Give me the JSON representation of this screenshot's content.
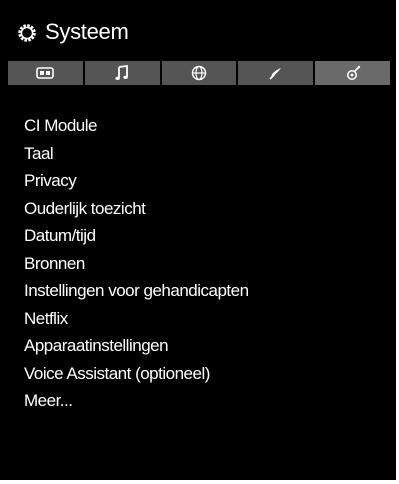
{
  "header": {
    "title": "Systeem",
    "icon": "settings-gear-icon"
  },
  "tabs": [
    {
      "icon": "picture-icon",
      "active": false
    },
    {
      "icon": "music-note-icon",
      "active": false
    },
    {
      "icon": "network-globe-icon",
      "active": false
    },
    {
      "icon": "installation-satellite-icon",
      "active": false
    },
    {
      "icon": "system-tools-icon",
      "active": true
    }
  ],
  "menu": {
    "items": [
      "CI Module",
      "Taal",
      "Privacy",
      "Ouderlijk toezicht",
      "Datum/tijd",
      "Bronnen",
      "Instellingen voor gehandicapten",
      "Netflix",
      "Apparaatinstellingen",
      "Voice Assistant (optioneel)",
      "Meer..."
    ]
  },
  "colors": {
    "panel_background": "#000000",
    "tab_bar": "#555555",
    "tab_active": "#6a6a6a",
    "text": "#ffffff"
  }
}
